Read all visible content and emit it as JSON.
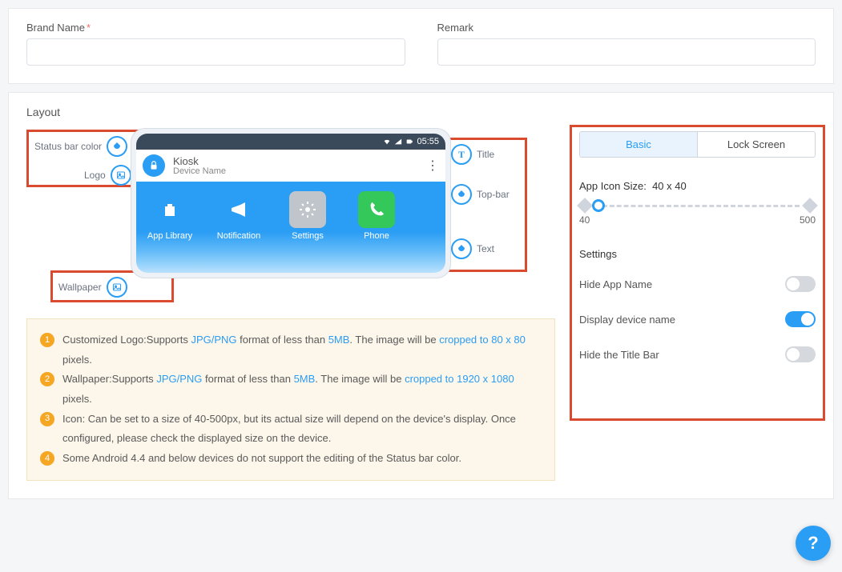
{
  "form": {
    "brand_label": "Brand Name",
    "remark_label": "Remark",
    "brand_value": "",
    "remark_value": ""
  },
  "layout": {
    "title": "Layout",
    "status_time": "05:55",
    "topbar_title": "Kiosk",
    "topbar_subtitle": "Device Name",
    "apps": [
      {
        "label": "App Library",
        "bg": "#2a9df4",
        "icon": "🛍"
      },
      {
        "label": "Notification",
        "bg": "#2a9df4",
        "icon": "📣"
      },
      {
        "label": "Settings",
        "bg": "#bfc5cb",
        "icon": "⚙"
      },
      {
        "label": "Phone",
        "bg": "#34c759",
        "icon": "📞"
      }
    ],
    "anno": {
      "status": "Status bar color",
      "logo": "Logo",
      "wallpaper": "Wallpaper",
      "title": "Title",
      "topbar": "Top-bar",
      "text": "Text"
    }
  },
  "info": {
    "n1_a": "Customized Logo:Supports ",
    "n1_link1": "JPG/PNG",
    "n1_b": " format of less than ",
    "n1_link2": "5MB",
    "n1_c": ". The image will be ",
    "n1_link3": "cropped to 80 x 80",
    "n1_d": " pixels.",
    "n2_a": "Wallpaper:Supports ",
    "n2_link1": "JPG/PNG",
    "n2_b": " format of less than ",
    "n2_link2": "5MB",
    "n2_c": ". The image will be ",
    "n2_link3": "cropped to 1920 x 1080",
    "n2_d": " pixels.",
    "n3": "Icon: Can be set to a size of 40-500px, but its actual size will depend on the device's display. Once configured, please check the displayed size on the device.",
    "n4": "Some Android 4.4 and below devices do not support the editing of the Status bar color."
  },
  "right": {
    "tab_basic": "Basic",
    "tab_lock": "Lock Screen",
    "icon_size_label": "App Icon Size:",
    "icon_size_value": "40 x 40",
    "slider_min": "40",
    "slider_max": "500",
    "settings_title": "Settings",
    "s1": "Hide App Name",
    "s2": "Display device name",
    "s3": "Hide the Title Bar",
    "s1_on": false,
    "s2_on": true,
    "s3_on": false
  },
  "fab": "?"
}
